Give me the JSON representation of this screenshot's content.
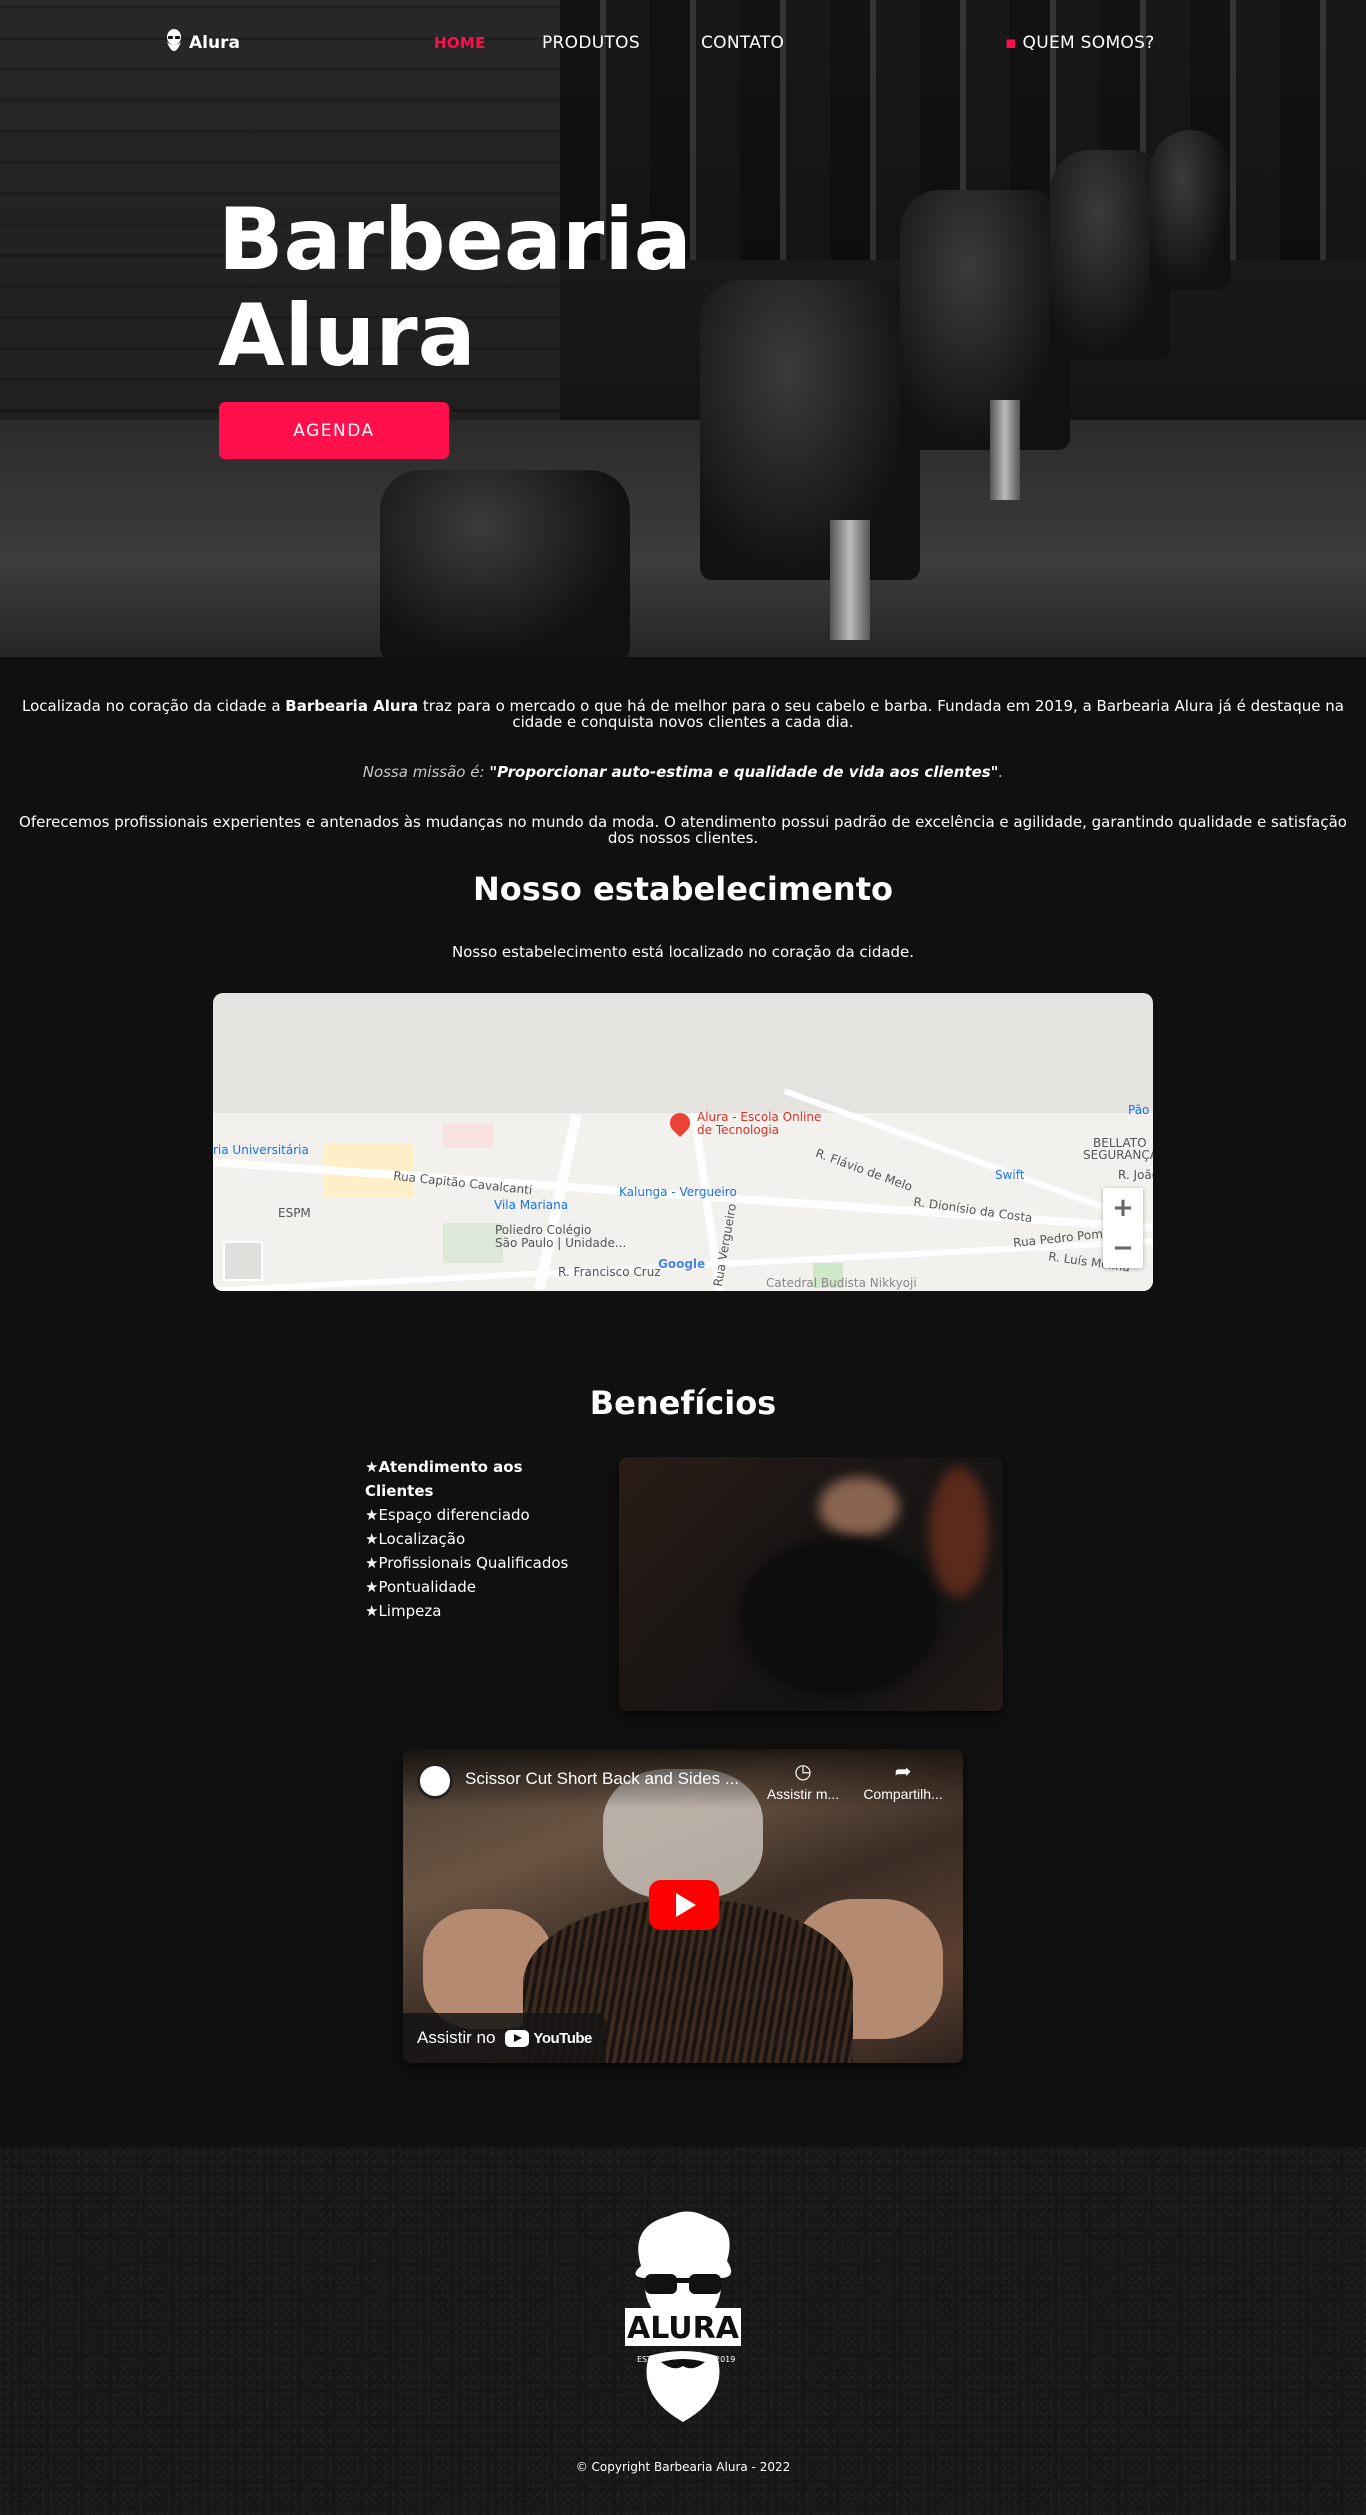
{
  "nav": {
    "logo_text": "Alura",
    "links": [
      "HOME",
      "PRODUTOS",
      "CONTATO",
      "QUEM SOMOS?"
    ]
  },
  "hero": {
    "title_line1": "Barbearia",
    "title_line2": "Alura",
    "button": "AGENDA"
  },
  "about": {
    "p1_before": "Localizada no coração da cidade a ",
    "p1_bold": "Barbearia Alura",
    "p1_after": " traz para o mercado o que há de melhor para o seu cabelo e barba. Fundada em 2019, a Barbearia Alura já é destaque na cidade e conquista novos clientes a cada dia.",
    "mission_label": "Nossa missão é: ",
    "mission_quote": "\"Proporcionar auto-estima e qualidade de vida aos clientes\"",
    "mission_end": ".",
    "p3": "Oferecemos profissionais experientes e antenados às mudanças no mundo da moda. O atendimento possui padrão de excelência e agilidade, garantindo qualidade e satisfação dos nossos clientes."
  },
  "establishment": {
    "title": "Nosso estabelecimento",
    "subtitle": "Nosso estabelecimento está localizado no coração da cidade."
  },
  "map": {
    "labels": [
      "Alura - Escola Online",
      "de Tecnologia",
      "ria Universitária",
      "Rua Capitão Cavalcanti",
      "Vila Mariana",
      "Kalunga - Vergueiro",
      "ESPM",
      "Poliedro Colégio",
      "São Paulo | Unidade...",
      "R. Francisco Cruz",
      "Rua Vergueiro",
      "R. Flávio de Melo",
      "Swift",
      "R. Dionísio da Costa",
      "BELLATO",
      "SEGURANÇA E",
      "R. João",
      "Rua Pedro Pomp",
      "R. Luís Molina",
      "Catedral Budista Nikkyoji",
      "Pão"
    ],
    "google": "Google",
    "zoom_in": "+",
    "zoom_out": "−"
  },
  "benefits": {
    "title": "Benefícios",
    "items": [
      "★Atendimento aos Clientes",
      "★Espaço diferenciado",
      "★Localização",
      "★Profissionais Qualificados",
      "★Pontualidade",
      "★Limpeza"
    ]
  },
  "video": {
    "title": "Scissor Cut Short Back and Sides ...",
    "watch_later": "Assistir m...",
    "share": "Compartilh...",
    "watch_on": "Assistir no",
    "youtube": "YouTube"
  },
  "footer": {
    "logo_text": "ALURA",
    "estd": "ESTD",
    "year": "2019",
    "copyright": "© Copyright Barbearia Alura - 2022"
  },
  "colors": {
    "accent": "#ff0f4b",
    "background": "#101010"
  }
}
